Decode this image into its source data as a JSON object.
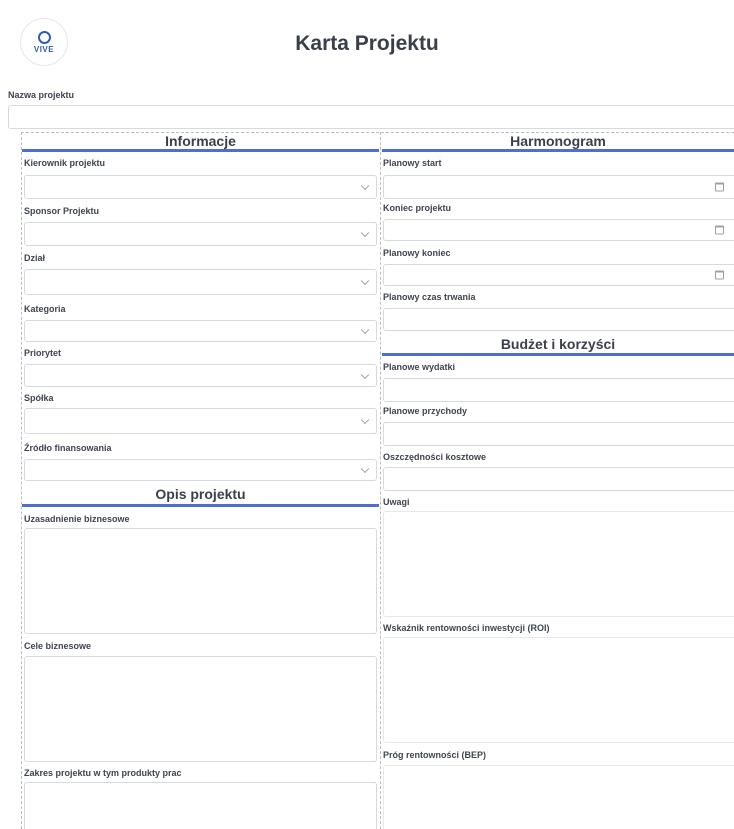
{
  "header": {
    "title": "Karta Projektu",
    "logo_text": "VIVE"
  },
  "form": {
    "project_name_label": "Nazwa projektu",
    "sections": {
      "info": "Informacje",
      "schedule": "Harmonogram",
      "description": "Opis projektu",
      "budget": "Budżet i korzyści"
    },
    "info_fields": [
      "Kierownik projektu",
      "Sponsor Projektu",
      "Dział",
      "Kategoria",
      "Priorytet",
      "Spółka",
      "Źródło finansowania"
    ],
    "schedule_fields": [
      "Planowy start",
      "Koniec projektu",
      "Planowy koniec",
      "Planowy czas trwania"
    ],
    "budget_fields": [
      "Planowe wydatki",
      "Planowe przychody",
      "Oszczędności kosztowe",
      "Uwagi",
      "Wskaźnik rentowności inwestycji (ROI)",
      "Próg rentowności (BEP)"
    ],
    "description_fields": [
      "Uzasadnienie biznesowe",
      "Cele biznesowe",
      "Zakres projektu w tym produkty prac"
    ]
  }
}
